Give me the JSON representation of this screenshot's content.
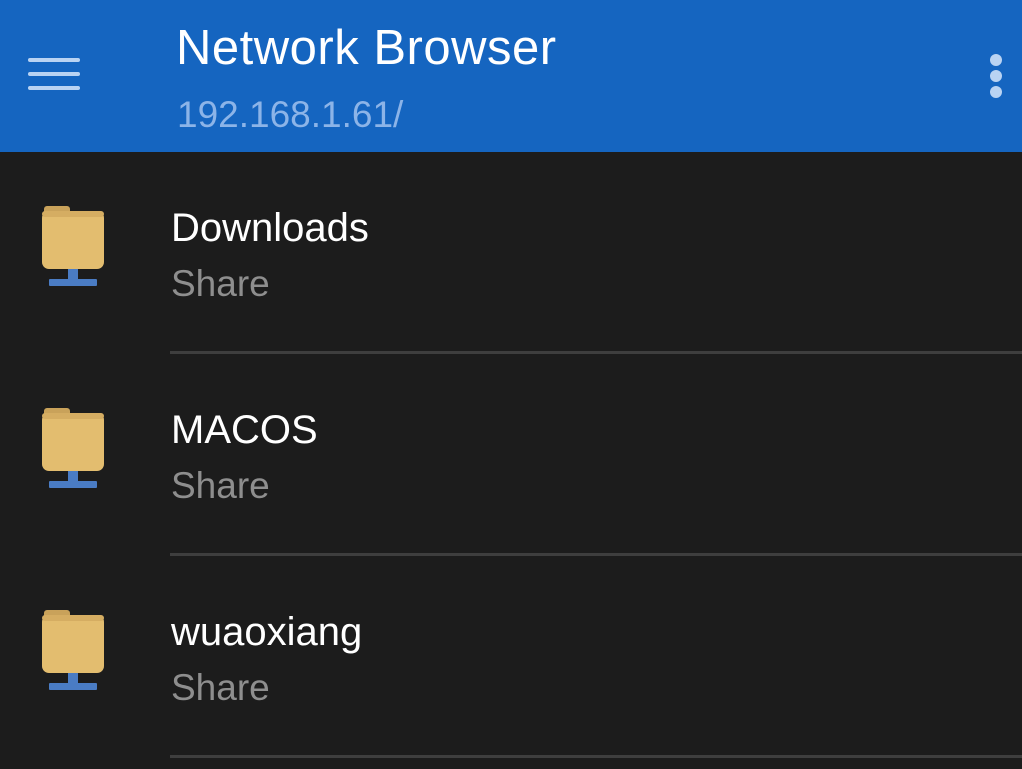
{
  "appbar": {
    "menu_icon": "hamburger-menu-icon",
    "title": "Network Browser",
    "path": "192.168.1.61/",
    "overflow_icon": "more-vertical-icon",
    "background_color": "#1565c0"
  },
  "shares": [
    {
      "name": "Downloads",
      "type": "Share",
      "icon": "network-folder-icon"
    },
    {
      "name": "MACOS",
      "type": "Share",
      "icon": "network-folder-icon"
    },
    {
      "name": "wuaoxiang",
      "type": "Share",
      "icon": "network-folder-icon"
    }
  ],
  "colors": {
    "background": "#1c1c1c",
    "folder": "#e3bd6f",
    "network_base": "#4a7cc4"
  }
}
